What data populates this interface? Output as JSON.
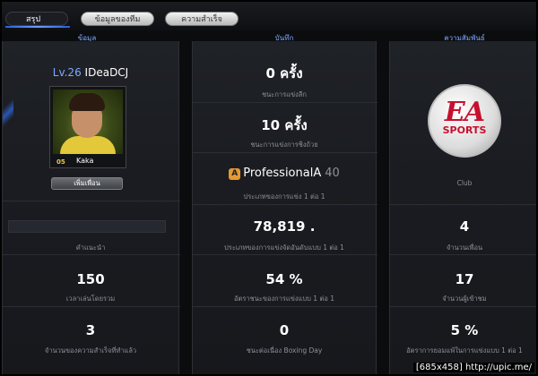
{
  "tabs": [
    {
      "label": "สรุป",
      "active": true
    },
    {
      "label": "ข้อมูลของทีม",
      "active": false
    },
    {
      "label": "ความสำเร็จ",
      "active": false
    }
  ],
  "headers": {
    "left": "ข้อมูล",
    "middle": "บันทึก",
    "right": "ความสัมพันธ์"
  },
  "player": {
    "level": "Lv.26",
    "name": "IDeaDCJ",
    "card_rating": "05",
    "card_name": "Kaka",
    "add_friend_label": "เพิ่มเพื่อน"
  },
  "left_stats": [
    {
      "value": "",
      "label": "คำแนะนำ"
    },
    {
      "value": "150",
      "label": "เวลาเล่นโดยรวม"
    },
    {
      "value": "3",
      "label": "จำนวนของความสำเร็จที่ทำแล้ว"
    }
  ],
  "middle_stats": {
    "wins_league": {
      "value": "0 ครั้ง",
      "label": "ชนะการแข่งลีก"
    },
    "wins_cup": {
      "value": "10 ครั้ง",
      "label": "ชนะการแข่งการชิงถ้วย"
    },
    "division": {
      "icon_letter": "A",
      "name": "ProfessionalA",
      "number": "40",
      "label": "ประเภทของการแข่ง 1 ต่อ 1"
    },
    "ranking": {
      "value": "78,819 .",
      "label": "ประเภทของการแข่งจัดอันดับแบบ 1 ต่อ 1"
    },
    "win_rate": {
      "value": "54 %",
      "label": "อัตราชนะของการแข่งแบบ 1 ต่อ 1"
    },
    "boxing_day": {
      "value": "0",
      "label": "ชนะต่อเนื่อง Boxing Day"
    }
  },
  "right": {
    "club_label": "Club",
    "logo_text": "EA",
    "logo_sub": "SPORTS",
    "stats": [
      {
        "value": "4",
        "label": "จำนวนเพื่อน"
      },
      {
        "value": "17",
        "label": "จำนวนผู้เข้าชม"
      },
      {
        "value": "5 %",
        "label": "อัตราการยอมแพ้ในการแข่งแบบ 1 ต่อ 1"
      }
    ]
  },
  "watermark": "[685x458] http://upic.me/",
  "colors": {
    "accent": "#7fa8ff",
    "ea_red": "#c8102e",
    "tab_underline": "#2b5fd8"
  }
}
